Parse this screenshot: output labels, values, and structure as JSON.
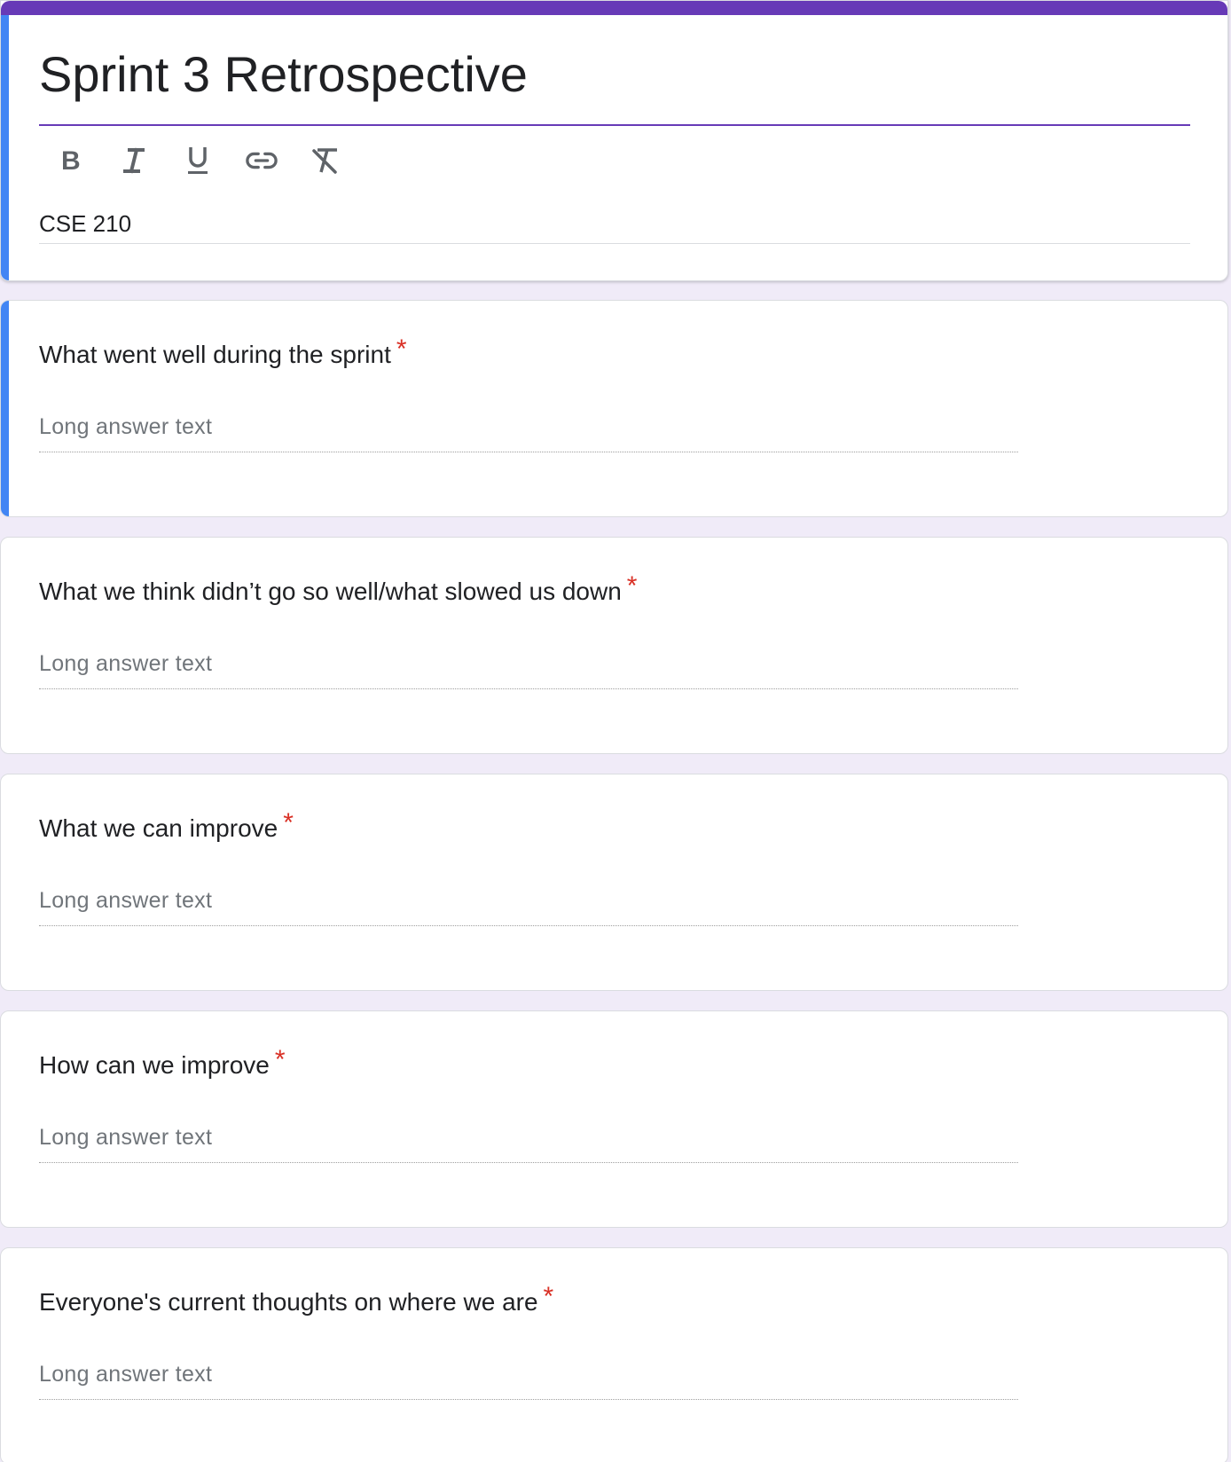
{
  "form": {
    "title": "Sprint 3 Retrospective",
    "description": "CSE 210",
    "accent_color": "#673ab7",
    "active_color": "#4285f4"
  },
  "toolbar": {
    "buttons": [
      {
        "name": "bold",
        "icon": "bold-icon"
      },
      {
        "name": "italic",
        "icon": "italic-icon"
      },
      {
        "name": "underline",
        "icon": "underline-icon"
      },
      {
        "name": "link",
        "icon": "link-icon"
      },
      {
        "name": "clear-formatting",
        "icon": "clear-format-icon"
      }
    ]
  },
  "questions": [
    {
      "title": "What went well during the sprint",
      "required_mark": "*",
      "answer_placeholder": "Long answer text"
    },
    {
      "title": "What we think didn’t go so well/what slowed us down",
      "required_mark": "*",
      "answer_placeholder": "Long answer text"
    },
    {
      "title": "What we can improve",
      "required_mark": "*",
      "answer_placeholder": "Long answer text"
    },
    {
      "title": "How can we improve",
      "required_mark": "*",
      "answer_placeholder": "Long answer text"
    },
    {
      "title": "Everyone's current thoughts on where we are",
      "required_mark": "*",
      "answer_placeholder": "Long answer text"
    }
  ]
}
